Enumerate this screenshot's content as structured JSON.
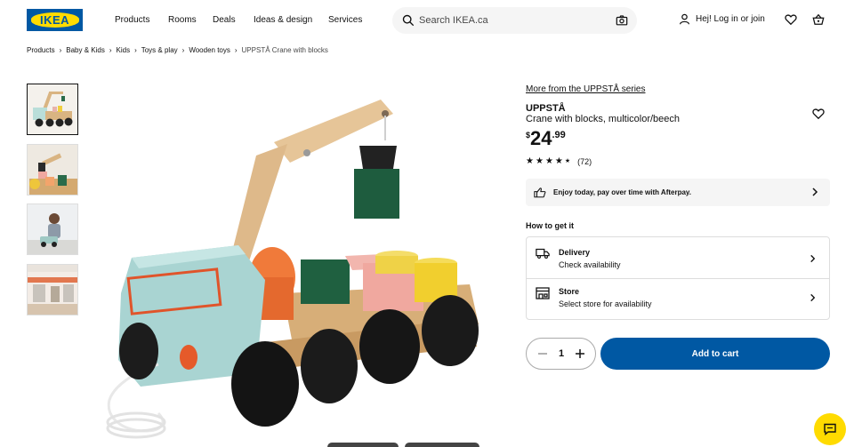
{
  "header": {
    "logo_text": "IKEA",
    "nav": [
      "Products",
      "Rooms",
      "Deals",
      "Ideas & design",
      "Services"
    ],
    "search_placeholder": "Search IKEA.ca",
    "login_text": "Hej! Log in or join"
  },
  "breadcrumb": [
    "Products",
    "Baby & Kids",
    "Kids",
    "Toys & play",
    "Wooden toys",
    "UPPSTÅ Crane with blocks"
  ],
  "product": {
    "series_link": "More from the UPPSTÅ series",
    "name": "UPPSTÅ",
    "description": "Crane with blocks, multicolor/beech",
    "price_currency": "$",
    "price_integer": "24",
    "price_decimal": ".99",
    "rating_stars": 4.5,
    "review_count": "(72)"
  },
  "afterpay": {
    "text": "Enjoy today, pay over time with Afterpay."
  },
  "delivery": {
    "heading": "How to get it",
    "delivery_title": "Delivery",
    "delivery_sub": "Check availability",
    "store_title": "Store",
    "store_sub": "Select store for availability"
  },
  "cart": {
    "quantity": "1",
    "add_label": "Add to cart"
  },
  "colors": {
    "brand_blue": "#0058a3",
    "brand_yellow": "#ffdb00"
  },
  "icons": [
    "search-icon",
    "camera-icon",
    "user-icon",
    "heart-icon",
    "basket-icon",
    "star-icon",
    "afterpay-icon",
    "truck-icon",
    "store-icon",
    "chevron-right-icon",
    "minus-icon",
    "plus-icon",
    "chat-icon"
  ]
}
